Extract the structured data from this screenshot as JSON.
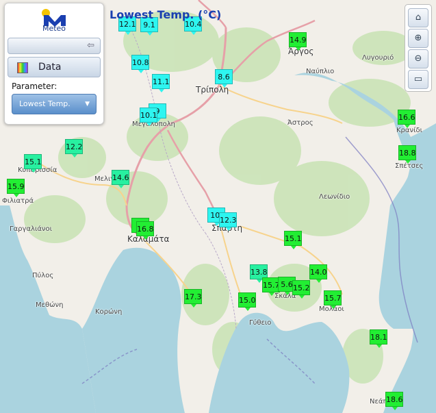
{
  "title": "Lowest Temp. (°C)",
  "logo": {
    "text": "Meteo",
    "icon": "meteo-logo-icon"
  },
  "panel": {
    "data_label": "Data",
    "parameter_label": "Parameter:",
    "parameter_value": "Lowest Temp.",
    "slider_icon": "arrow-left-icon"
  },
  "tools": [
    "home-icon",
    "zoom-in-icon",
    "zoom-out-icon",
    "fullscreen-icon"
  ],
  "colors": {
    "cyan": "#2ef5f0",
    "mint": "#28f0a0",
    "green": "#22ee33",
    "title": "#1a3fb0",
    "sea": "#aad3df"
  },
  "stations": [
    {
      "value": "12.1",
      "tone": "c"
    },
    {
      "value": "9.1",
      "tone": "c"
    },
    {
      "value": "10.4",
      "tone": "c"
    },
    {
      "value": "14.9",
      "tone": "g"
    },
    {
      "value": "10.8",
      "tone": "c"
    },
    {
      "value": "8.6",
      "tone": "c"
    },
    {
      "value": "11.1",
      "tone": "c"
    },
    {
      "value": "9",
      "tone": "c"
    },
    {
      "value": "10.1",
      "tone": "c"
    },
    {
      "value": "16.6",
      "tone": "g"
    },
    {
      "value": "12.2",
      "tone": "m"
    },
    {
      "value": "18.8",
      "tone": "g"
    },
    {
      "value": "15.1",
      "tone": "m"
    },
    {
      "value": "14.6",
      "tone": "m"
    },
    {
      "value": "15.9",
      "tone": "g"
    },
    {
      "value": "10.",
      "tone": "c"
    },
    {
      "value": "12.3",
      "tone": "c"
    },
    {
      "value": "1",
      "tone": "g"
    },
    {
      "value": "16.8",
      "tone": "g"
    },
    {
      "value": "15.1",
      "tone": "g"
    },
    {
      "value": "13.8",
      "tone": "m"
    },
    {
      "value": "14.0",
      "tone": "g"
    },
    {
      "value": "15.7",
      "tone": "g"
    },
    {
      "value": "5.6",
      "tone": "g"
    },
    {
      "value": "15.2",
      "tone": "g"
    },
    {
      "value": "17.3",
      "tone": "g"
    },
    {
      "value": "15.0",
      "tone": "g"
    },
    {
      "value": "15.7",
      "tone": "g"
    },
    {
      "value": "18.1",
      "tone": "g"
    },
    {
      "value": "18.6",
      "tone": "g"
    }
  ],
  "places": [
    "Άργος",
    "Ναύπλιο",
    "Λυγουριό",
    "Τρίπολη",
    "Μεγαλόπολη",
    "Άστρος",
    "Κρανίδι",
    "Σπέτσες",
    "Κυπαρισσία",
    "Μελιγ",
    "Φιλιατρά",
    "Λεωνίδιο",
    "Γαργαλιάνοι",
    "Σπάρτη",
    "Καλαμάτα",
    "Πύλος",
    "Σκάλα",
    "Μολάοι",
    "Μεθώνη",
    "Κορώνη",
    "Γύθειο",
    "Νεάπ"
  ]
}
